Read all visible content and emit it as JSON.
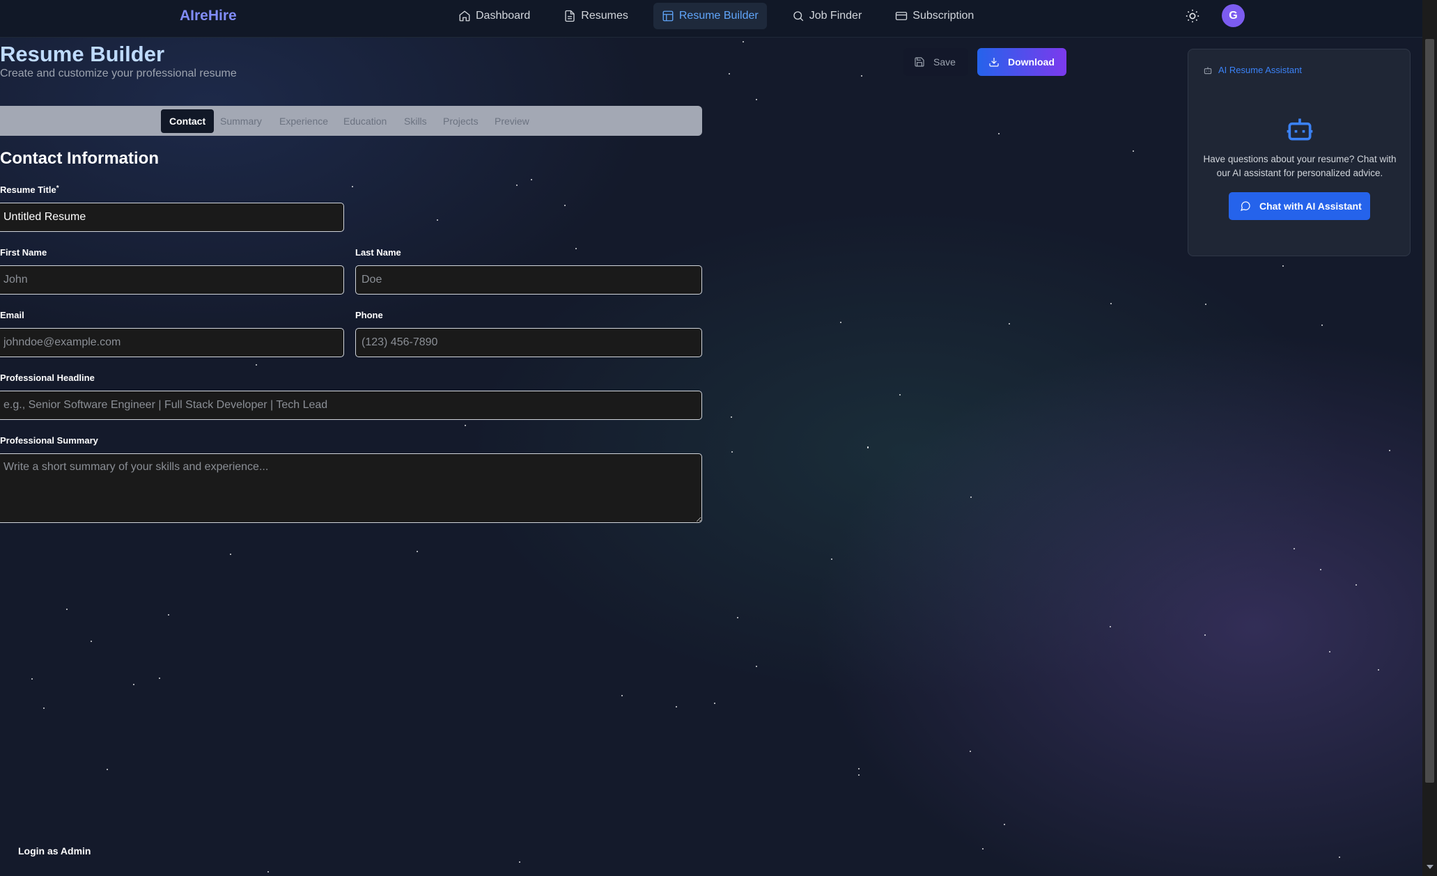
{
  "app": {
    "brand": "AIreHire"
  },
  "nav": {
    "items": [
      {
        "label": "Dashboard",
        "icon": "home-icon"
      },
      {
        "label": "Resumes",
        "icon": "file-text-icon"
      },
      {
        "label": "Resume Builder",
        "icon": "layout-icon",
        "active": true
      },
      {
        "label": "Job Finder",
        "icon": "search-icon"
      },
      {
        "label": "Subscription",
        "icon": "credit-card-icon"
      }
    ],
    "theme_toggle_icon": "sun-icon",
    "avatar_initial": "G"
  },
  "header": {
    "title": "Resume Builder",
    "subtitle": "Create and customize your professional resume",
    "save_label": "Save",
    "download_label": "Download"
  },
  "tabs": {
    "items": [
      {
        "label": "Contact",
        "active": true
      },
      {
        "label": "Summary"
      },
      {
        "label": "Experience"
      },
      {
        "label": "Education"
      },
      {
        "label": "Skills"
      },
      {
        "label": "Projects"
      },
      {
        "label": "Preview"
      }
    ]
  },
  "form": {
    "section_title": "Contact Information",
    "resume_title": {
      "label": "Resume Title",
      "required_mark": "*",
      "value": "Untitled Resume"
    },
    "first_name": {
      "label": "First Name",
      "placeholder": "John"
    },
    "last_name": {
      "label": "Last Name",
      "placeholder": "Doe"
    },
    "email": {
      "label": "Email",
      "placeholder": "johndoe@example.com"
    },
    "phone": {
      "label": "Phone",
      "placeholder": "(123) 456-7890"
    },
    "headline": {
      "label": "Professional Headline",
      "placeholder": "e.g., Senior Software Engineer | Full Stack Developer | Tech Lead"
    },
    "summary": {
      "label": "Professional Summary",
      "placeholder": "Write a short summary of your skills and experience..."
    }
  },
  "assistant": {
    "title": "AI Resume Assistant",
    "description": "Have questions about your resume? Chat with our AI assistant for personalized advice.",
    "button_label": "Chat with AI Assistant"
  },
  "footer": {
    "admin_link": "Login as Admin"
  },
  "colors": {
    "accent": "#2563eb",
    "brand": "#818cf8",
    "background": "#141a2b",
    "nav_bg": "#111827",
    "download_gradient_end": "#7c3aed"
  }
}
